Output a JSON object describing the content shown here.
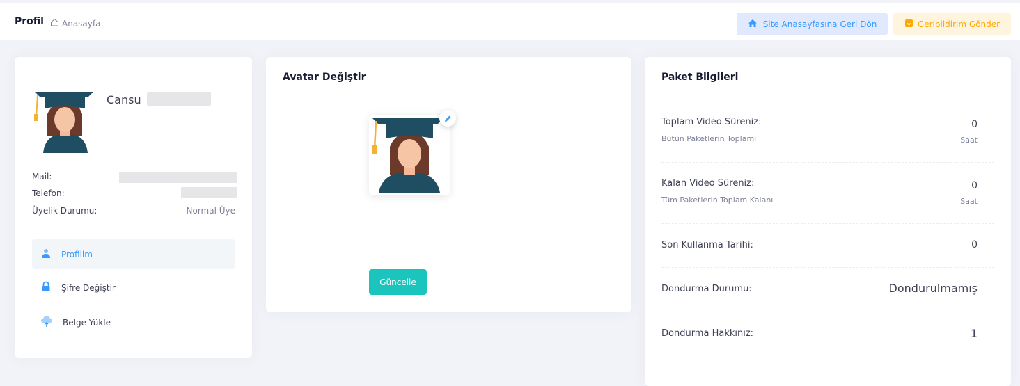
{
  "header": {
    "title": "Profil",
    "breadcrumb": "Anasayfa",
    "site_button": "Site Anasayfasına Geri Dön",
    "feedback_button": "Geribildirim Gönder"
  },
  "profile": {
    "name": "Cansu",
    "mail_label": "Mail:",
    "phone_label": "Telefon:",
    "membership_label": "Üyelik Durumu:",
    "membership_value": "Normal Üye",
    "nav": [
      {
        "label": "Profilim",
        "icon": "user-icon"
      },
      {
        "label": "Şifre Değiştir",
        "icon": "lock-icon"
      },
      {
        "label": "Belge Yükle",
        "icon": "cloud-upload-icon"
      }
    ]
  },
  "avatar_card": {
    "title": "Avatar Değiştir",
    "update_button": "Güncelle"
  },
  "package_card": {
    "title": "Paket Bilgileri",
    "rows": [
      {
        "label": "Toplam Video Süreniz:",
        "sub": "Bütün Paketlerin Toplamı",
        "value": "0",
        "unit": "Saat"
      },
      {
        "label": "Kalan Video Süreniz:",
        "sub": "Tüm Paketlerin Toplam Kalanı",
        "value": "0",
        "unit": "Saat"
      },
      {
        "label": "Son Kullanma Tarihi:",
        "value": "0"
      },
      {
        "label": "Dondurma Durumu:",
        "value": "Dondurulmamış"
      },
      {
        "label": "Dondurma Hakkınız:",
        "value": "1"
      }
    ]
  },
  "colors": {
    "accent": "#3699ff",
    "success": "#1bc5bd",
    "warning": "#ffa800",
    "avatar_cap": "#1f4e62",
    "avatar_tassel": "#f2b233"
  }
}
